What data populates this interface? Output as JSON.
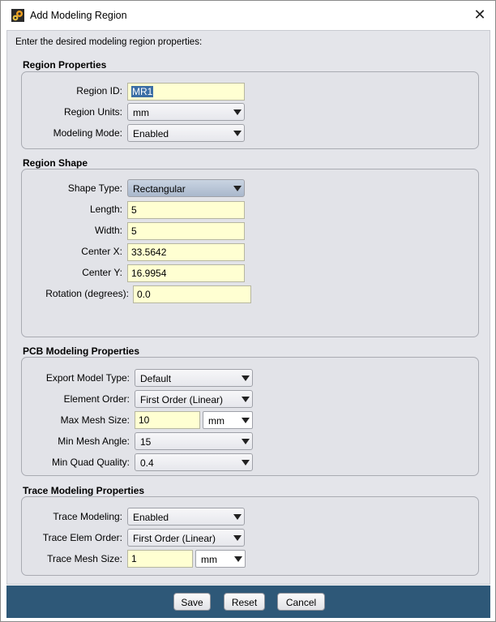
{
  "window": {
    "title": "Add Modeling Region",
    "close_glyph": "✕",
    "icon": "app-gear-icon"
  },
  "instructions": "Enter the desired modeling region properties:",
  "region_properties": {
    "title": "Region Properties",
    "region_id": {
      "label": "Region ID:",
      "value": "MR1"
    },
    "region_units": {
      "label": "Region Units:",
      "value": "mm"
    },
    "modeling_mode": {
      "label": "Modeling Mode:",
      "value": "Enabled"
    }
  },
  "region_shape": {
    "title": "Region Shape",
    "shape_type": {
      "label": "Shape Type:",
      "value": "Rectangular"
    },
    "length": {
      "label": "Length:",
      "value": "5"
    },
    "width": {
      "label": "Width:",
      "value": "5"
    },
    "center_x": {
      "label": "Center X:",
      "value": "33.5642"
    },
    "center_y": {
      "label": "Center Y:",
      "value": "16.9954"
    },
    "rotation": {
      "label": "Rotation (degrees):",
      "value": "0.0"
    }
  },
  "pcb_modeling": {
    "title": "PCB Modeling Properties",
    "export_model_type": {
      "label": "Export Model Type:",
      "value": "Default"
    },
    "element_order": {
      "label": "Element Order:",
      "value": "First Order (Linear)"
    },
    "max_mesh_size": {
      "label": "Max Mesh Size:",
      "value": "10",
      "unit": "mm"
    },
    "min_mesh_angle": {
      "label": "Min Mesh Angle:",
      "value": "15"
    },
    "min_quad_quality": {
      "label": "Min Quad Quality:",
      "value": "0.4"
    }
  },
  "trace_modeling": {
    "title": "Trace Modeling Properties",
    "trace_modeling": {
      "label": "Trace Modeling:",
      "value": "Enabled"
    },
    "trace_elem_order": {
      "label": "Trace Elem Order:",
      "value": "First Order (Linear)"
    },
    "trace_mesh_size": {
      "label": "Trace Mesh Size:",
      "value": "1",
      "unit": "mm"
    }
  },
  "buttons": {
    "save": "Save",
    "reset": "Reset",
    "cancel": "Cancel"
  },
  "colors": {
    "field_bg": "#ffffd2",
    "footer_bg": "#2e5878",
    "panel_bg": "#e4e5ea",
    "selection": "#3b6ea5"
  }
}
